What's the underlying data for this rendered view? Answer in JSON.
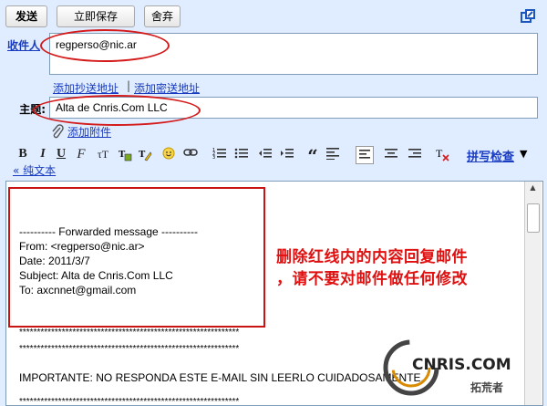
{
  "toolbar": {
    "send_label": "发送",
    "save_now_label": "立即保存",
    "discard_label": "舍弃"
  },
  "compose": {
    "to_label": "收件人",
    "to_value": "regperso@nic.ar",
    "add_cc_label": "添加抄送地址",
    "separator": "|",
    "add_bcc_label": "添加密送地址",
    "subject_label": "主题:",
    "subject_value": "Alta de Cnris.Com LLC",
    "attach_label": "添加附件"
  },
  "format_toolbar": {
    "buttons": [
      "bold",
      "italic",
      "underline",
      "font",
      "size",
      "text-color",
      "highlight",
      "emoticon",
      "link",
      "numbered-list",
      "bulleted-list",
      "outdent",
      "indent",
      "quote",
      "align-left",
      "align-center",
      "align-right",
      "remove-format"
    ],
    "spell_check_label": "拼写检查",
    "spell_check_arrow": "▼",
    "plain_text_label": "« 纯文本"
  },
  "body": {
    "forward_header": "---------- Forwarded message ----------",
    "from_line": "From: <regperso@nic.ar>",
    "date_line": "Date: 2011/3/7",
    "subject_line": "Subject: Alta de Cnris.Com LLC",
    "to_line": "To: axcnnet@gmail.com",
    "stars_line_1": "**************************************************************",
    "stars_line_2": "**************************************************************",
    "importante_line": "IMPORTANTE: NO RESPONDA ESTE E-MAIL SIN LEERLO CUIDADOSAMENTE.",
    "stars_line_3": "**************************************************************"
  },
  "annotation": {
    "line1": "删除红线内的内容回复邮件",
    "line2": "，请不要对邮件做任何修改",
    "color": "#e01010"
  },
  "watermark": {
    "brand": "CNRIS.COM",
    "sub": "拓荒者"
  }
}
